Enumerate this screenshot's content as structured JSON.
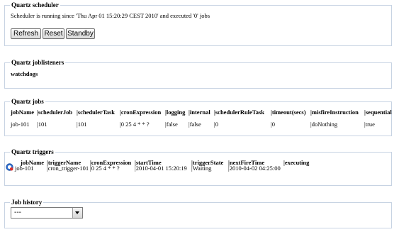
{
  "scheduler": {
    "legend": "Quartz scheduler",
    "status_text": "Scheduler is running since 'Thu Apr 01 15:20:29 CEST 2010' and executed '0' jobs",
    "buttons": {
      "refresh": "Refresh",
      "reset": "Reset",
      "standby": "Standby"
    }
  },
  "joblisteners": {
    "legend": "Quartz joblisteners",
    "items": [
      "watchdogs"
    ]
  },
  "jobs": {
    "legend": "Quartz jobs",
    "columns": [
      "jobName",
      "|schedulerJob",
      "|schedulerTask",
      "|cronExpression",
      "|logging",
      "|internal",
      "|schedulerRuleTask",
      "|timeout(secs)",
      "|misfireInstruction",
      "|sequential"
    ],
    "rows": [
      [
        "job-101",
        "|101",
        "|101",
        "|0 25 4 * * ?",
        "|false",
        "|false",
        "|0",
        "|0",
        "|doNothing",
        "|true"
      ]
    ]
  },
  "triggers": {
    "legend": "Quartz triggers",
    "columns": [
      "jobName",
      "|triggerName",
      "|cronExpression",
      "|startTime",
      "|triggerState",
      "|nextFireTime",
      "|executing"
    ],
    "rows": [
      {
        "icon": "run-now-icon",
        "cells": [
          "job-101",
          "|cron_trigger-101",
          "|0 25 4 * * ?",
          "|2010-04-01 15:20:19",
          "|Waiting",
          "|2010-04-02 04:25:00",
          ""
        ]
      }
    ]
  },
  "history": {
    "legend": "Job history",
    "select_value": "---"
  },
  "colors": {
    "fieldset_border": "#c7d3e3",
    "icon_blue": "#2f6fd1",
    "icon_red": "#d9302b"
  }
}
